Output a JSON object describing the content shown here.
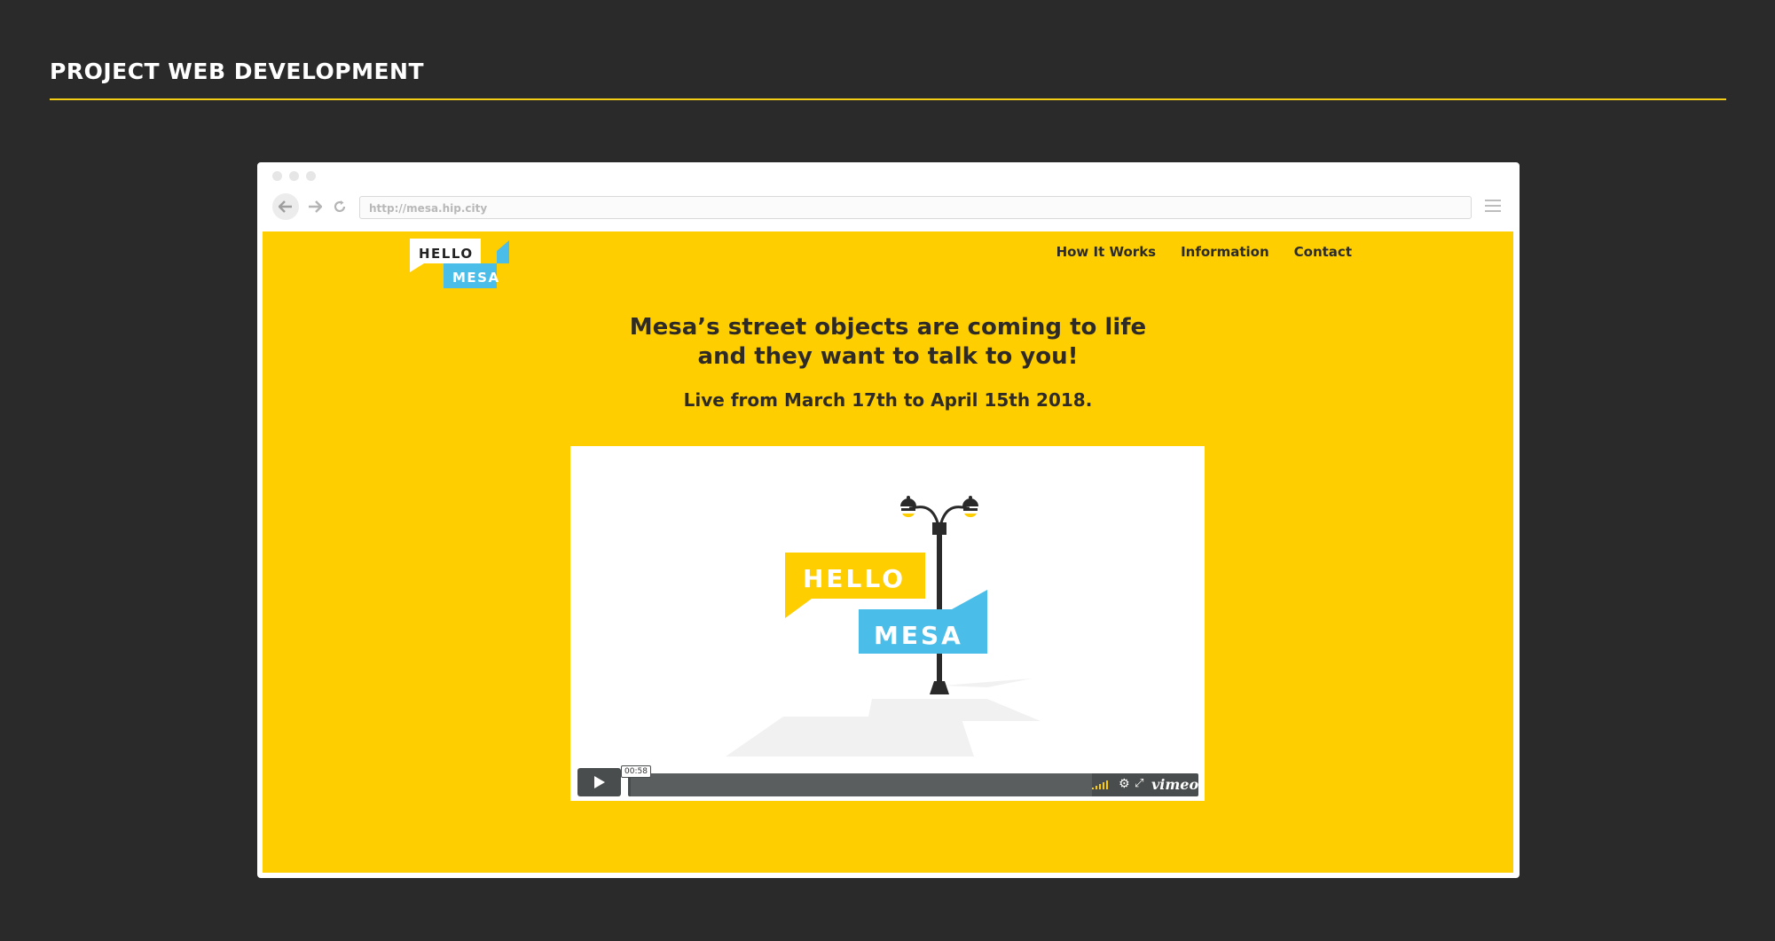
{
  "page": {
    "title": "PROJECT WEB DEVELOPMENT"
  },
  "browser": {
    "url": "http://mesa.hip.city"
  },
  "site": {
    "logo": {
      "line1": "HELLO",
      "line2": "MESA"
    },
    "nav": [
      "How It Works",
      "Information",
      "Contact"
    ],
    "headline_line1": "Mesa’s street objects are coming to life",
    "headline_line2": "and they want to talk to you!",
    "subline": "Live from March 17th to April 15th 2018."
  },
  "video": {
    "art_line1": "HELLO",
    "art_line2": "MESA",
    "time": "00:58",
    "brand": "vimeo"
  },
  "colors": {
    "background": "#2a2a2a",
    "accent_yellow": "#ffce00",
    "accent_blue": "#4bbde9",
    "text_dark": "#2e2b26"
  }
}
